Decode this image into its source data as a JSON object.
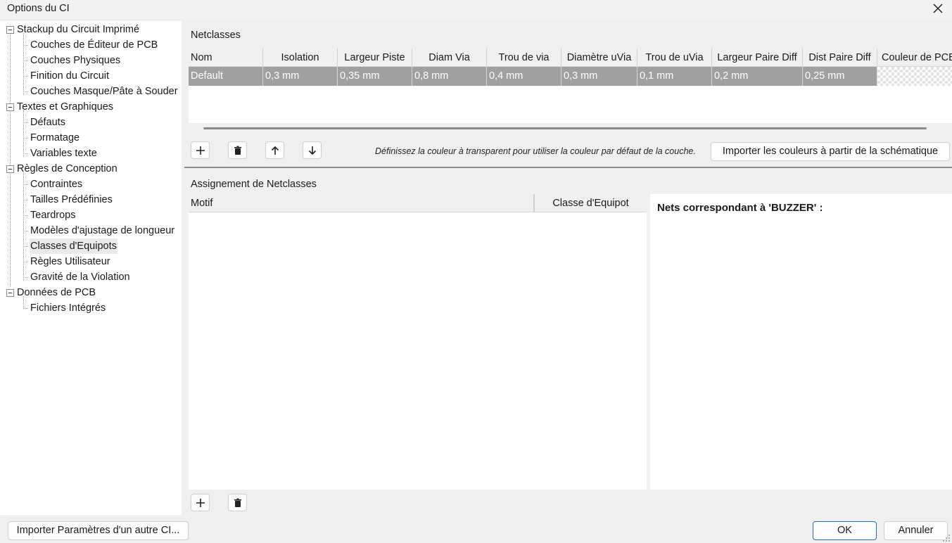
{
  "window": {
    "title": "Options du CI"
  },
  "tree": {
    "items": [
      {
        "label": "Stackup du Circuit Imprimé",
        "level": 0
      },
      {
        "label": "Couches de Éditeur de PCB",
        "level": 1
      },
      {
        "label": "Couches Physiques",
        "level": 1
      },
      {
        "label": "Finition du Circuit",
        "level": 1
      },
      {
        "label": "Couches Masque/Pâte à Souder",
        "level": 1
      },
      {
        "label": "Textes et Graphiques",
        "level": 0
      },
      {
        "label": "Défauts",
        "level": 1
      },
      {
        "label": "Formatage",
        "level": 1
      },
      {
        "label": "Variables texte",
        "level": 1
      },
      {
        "label": "Règles de Conception",
        "level": 0
      },
      {
        "label": "Contraintes",
        "level": 1
      },
      {
        "label": "Tailles Prédéfinies",
        "level": 1
      },
      {
        "label": "Teardrops",
        "level": 1
      },
      {
        "label": "Modèles d'ajustage de longueur",
        "level": 1
      },
      {
        "label": "Classes d'Equipots",
        "level": 1,
        "selected": true
      },
      {
        "label": "Règles Utilisateur",
        "level": 1
      },
      {
        "label": "Gravité de la Violation",
        "level": 1
      },
      {
        "label": "Données de PCB",
        "level": 0
      },
      {
        "label": "Fichiers Intégrés",
        "level": 1
      }
    ]
  },
  "netclasses": {
    "title": "Netclasses",
    "columns": [
      "Nom",
      "Isolation",
      "Largeur Piste",
      "Diam Via",
      "Trou de via",
      "Diamètre uVia",
      "Trou de uVia",
      "Largeur Paire Diff",
      "Dist Paire Diff",
      "Couleur de PCB"
    ],
    "rows": [
      {
        "cells": [
          "Default",
          "0,3 mm",
          "0,35 mm",
          "0,8 mm",
          "0,4 mm",
          "0,3 mm",
          "0,1 mm",
          "0,2 mm",
          "0,25 mm",
          ""
        ]
      }
    ],
    "hint": "Définissez la couleur à transparent pour utiliser la couleur par défaut de la couche.",
    "import_colors_label": "Importer les couleurs à partir de la schématique"
  },
  "assignment": {
    "title": "Assignement de Netclasses",
    "columns": [
      "Motif",
      "Classe d'Equipot"
    ],
    "nets_title": "Nets correspondant à 'BUZZER' :"
  },
  "footer": {
    "import_label": "Importer Paramètres d'un autre CI...",
    "ok_label": "OK",
    "cancel_label": "Annuler"
  },
  "colors": {
    "accent": "#1f6fc4",
    "selected_row": "#a0a0a0"
  }
}
